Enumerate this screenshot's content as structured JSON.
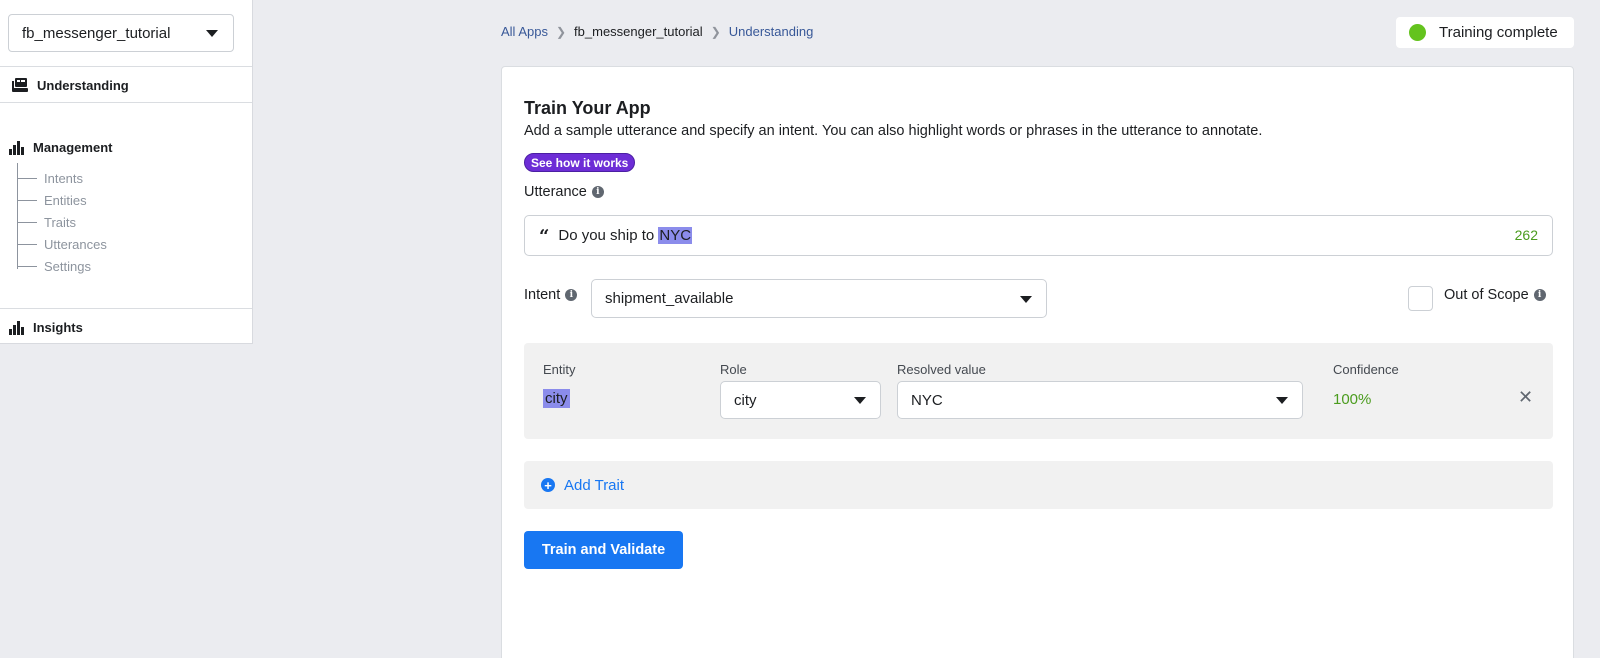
{
  "sidebar": {
    "app_select": "fb_messenger_tutorial",
    "understanding": "Understanding",
    "management": "Management",
    "management_items": [
      "Intents",
      "Entities",
      "Traits",
      "Utterances",
      "Settings"
    ],
    "insights": "Insights"
  },
  "breadcrumb": {
    "all_apps": "All Apps",
    "app": "fb_messenger_tutorial",
    "current": "Understanding"
  },
  "status": {
    "label": "Training complete",
    "color": "#64c31e"
  },
  "train": {
    "title": "Train Your App",
    "description": "Add a sample utterance and specify an intent. You can also highlight words or phrases in the utterance to annotate.",
    "how_button": "See how it works",
    "utterance_label": "Utterance",
    "utterance_prefix": "Do you ship to ",
    "utterance_highlight": "NYC",
    "char_count": "262",
    "intent_label": "Intent",
    "intent_value": "shipment_available",
    "out_of_scope_label": "Out of Scope",
    "out_of_scope_checked": false
  },
  "entity": {
    "headers": {
      "entity": "Entity",
      "role": "Role",
      "resolved": "Resolved value",
      "confidence": "Confidence"
    },
    "row": {
      "entity": "city",
      "role": "city",
      "resolved": "NYC",
      "confidence": "100%"
    }
  },
  "add_trait": "Add Trait",
  "train_button": "Train and Validate",
  "colors": {
    "primary": "#1877f2",
    "highlight": "#8b8ceb",
    "success": "#4b9c1e",
    "how_button": "#6d2dd6"
  }
}
